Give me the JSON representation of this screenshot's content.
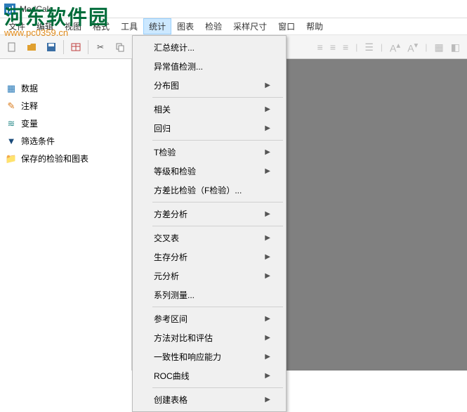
{
  "titlebar": {
    "app_name": "MedCalc"
  },
  "menubar": {
    "items": [
      "文件",
      "编辑",
      "视图",
      "格式",
      "工具",
      "统计",
      "图表",
      "检验",
      "采样尺寸",
      "窗口",
      "帮助"
    ],
    "active_index": 5
  },
  "watermark": {
    "text": "河东软件园",
    "url": "www.pc0359.cn"
  },
  "sidebar": {
    "nodes": [
      {
        "icon": "grid-icon",
        "icon_class": "ic-blue",
        "label": "数据"
      },
      {
        "icon": "note-icon",
        "icon_class": "ic-orange",
        "label": "注释"
      },
      {
        "icon": "wave-icon",
        "icon_class": "ic-teal",
        "label": "变量"
      },
      {
        "icon": "filter-icon",
        "icon_class": "ic-navy",
        "label": "筛选条件"
      },
      {
        "icon": "folder-icon",
        "icon_class": "ic-orange",
        "label": "保存的检验和图表"
      }
    ]
  },
  "dropdown": {
    "groups": [
      [
        {
          "label": "汇总统计...",
          "sub": false
        },
        {
          "label": "异常值检测...",
          "sub": false
        },
        {
          "label": "分布图",
          "sub": true
        }
      ],
      [
        {
          "label": "相关",
          "sub": true
        },
        {
          "label": "回归",
          "sub": true
        }
      ],
      [
        {
          "label": "T检验",
          "sub": true
        },
        {
          "label": "等级和检验",
          "sub": true
        },
        {
          "label": "方差比检验（F检验）...",
          "sub": false
        }
      ],
      [
        {
          "label": "方差分析",
          "sub": true
        }
      ],
      [
        {
          "label": "交叉表",
          "sub": true
        },
        {
          "label": "生存分析",
          "sub": true
        },
        {
          "label": "元分析",
          "sub": true
        },
        {
          "label": "系列测量...",
          "sub": false
        }
      ],
      [
        {
          "label": "参考区间",
          "sub": true
        },
        {
          "label": "方法对比和评估",
          "sub": true
        },
        {
          "label": "一致性和响应能力",
          "sub": true
        },
        {
          "label": "ROC曲线",
          "sub": true
        }
      ],
      [
        {
          "label": "创建表格",
          "sub": true
        }
      ]
    ]
  },
  "toolbar": {
    "icons": [
      "new",
      "open",
      "save",
      "table",
      "scissors",
      "copy",
      "paste"
    ]
  },
  "toolbar_right": {
    "icons": [
      "align-left",
      "align-center",
      "align-right",
      "list",
      "font-up",
      "font-down",
      "layout1",
      "layout2"
    ]
  }
}
